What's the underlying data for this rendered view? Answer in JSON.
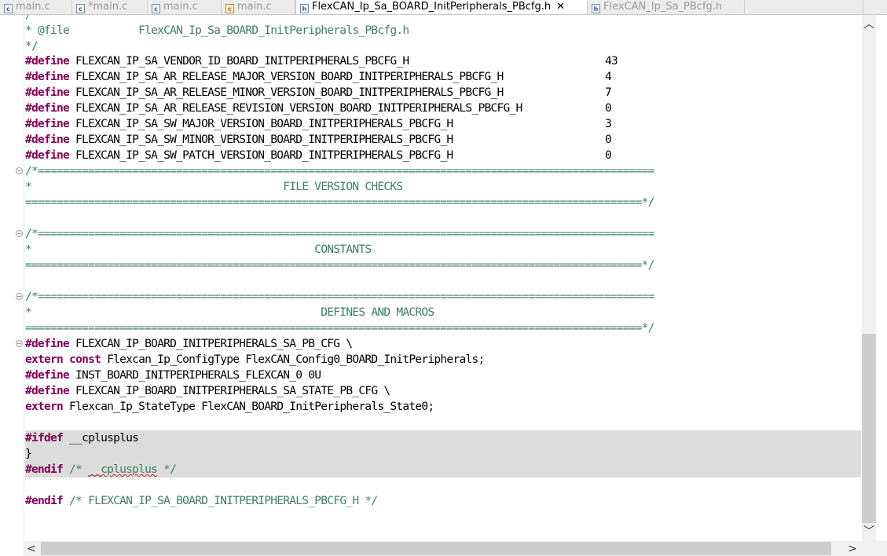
{
  "tabs": [
    {
      "label": "main.c",
      "icon": "c-file-icon",
      "active": false
    },
    {
      "label": "*main.c",
      "icon": "c-file-icon",
      "active": false
    },
    {
      "label": "main.c",
      "icon": "c-file-icon",
      "active": false
    },
    {
      "label": "main.c",
      "icon": "c-file-warning-icon",
      "active": false
    },
    {
      "label": "FlexCAN_Ip_Sa_BOARD_InitPeripherals_PBcfg.h",
      "icon": "h-file-icon",
      "active": true,
      "close": "✕"
    },
    {
      "label": "FlexCAN_Ip_Sa_PBcfg.h",
      "icon": "h-file-icon",
      "active": false
    }
  ],
  "code": {
    "l0": "/",
    "l1_comment": "* @file           FlexCAN_Ip_Sa_BOARD_InitPeripherals_PBcfg.h",
    "l2_comment": "*/",
    "kw_define": "#define",
    "kw_extern": "extern",
    "kw_const": "const",
    "kw_ifdef": "#ifdef",
    "kw_endif": "#endif",
    "defines": [
      {
        "name": " FLEXCAN_IP_SA_VENDOR_ID_BOARD_INITPERIPHERALS_PBCFG_H",
        "value": "43"
      },
      {
        "name": " FLEXCAN_IP_SA_AR_RELEASE_MAJOR_VERSION_BOARD_INITPERIPHERALS_PBCFG_H",
        "value": "4"
      },
      {
        "name": " FLEXCAN_IP_SA_AR_RELEASE_MINOR_VERSION_BOARD_INITPERIPHERALS_PBCFG_H",
        "value": "7"
      },
      {
        "name": " FLEXCAN_IP_SA_AR_RELEASE_REVISION_VERSION_BOARD_INITPERIPHERALS_PBCFG_H",
        "value": "0"
      },
      {
        "name": " FLEXCAN_IP_SA_SW_MAJOR_VERSION_BOARD_INITPERIPHERALS_PBCFG_H",
        "value": "3"
      },
      {
        "name": " FLEXCAN_IP_SA_SW_MINOR_VERSION_BOARD_INITPERIPHERALS_PBCFG_H",
        "value": "0"
      },
      {
        "name": " FLEXCAN_IP_SA_SW_PATCH_VERSION_BOARD_INITPERIPHERALS_PBCFG_H",
        "value": "0"
      }
    ],
    "banner_open": "/*==================================================================================================",
    "banner_close": "==================================================================================================*/",
    "section_fvc": "*                                        FILE VERSION CHECKS",
    "section_const": "*                                             CONSTANTS",
    "section_defs": "*                                              DEFINES AND MACROS",
    "m1_rest": " FLEXCAN_IP_BOARD_INITPERIPHERALS_SA_PB_CFG \\",
    "m2_rest": " Flexcan_Ip_ConfigType FlexCAN_Config0_BOARD_InitPeripherals;",
    "m3_rest": " INST_BOARD_INITPERIPHERALS_FLEXCAN_0 0U",
    "m4_rest": " FLEXCAN_IP_BOARD_INITPERIPHERALS_SA_STATE_PB_CFG \\",
    "m5_rest": " Flexcan_Ip_StateType FlexCAN_BOARD_InitPeripherals_State0;",
    "ifdef_rest": " __cplusplus",
    "brace": "}",
    "endif1_pre": " /* ",
    "endif1_sym": "__cplusplus",
    "endif1_post": " */",
    "endif2_comment": " /* FLEXCAN_IP_SA_BOARD_INITPERIPHERALS_PBCFG_H */"
  },
  "scroll": {
    "up": "︿",
    "down": "﹀",
    "left": "<",
    "right": ">"
  }
}
